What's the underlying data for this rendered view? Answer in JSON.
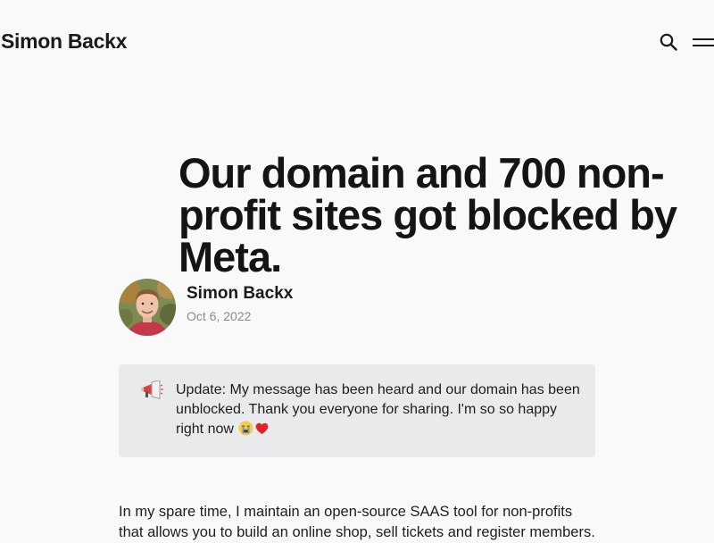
{
  "header": {
    "site_title": "Simon Backx",
    "search_icon": "search-icon",
    "menu_icon": "hamburger-menu-icon"
  },
  "post": {
    "title_lines": [
      "Our domain and 700 non-",
      "profit sites got blocked by",
      "Meta."
    ],
    "author": {
      "name": "Simon Backx",
      "date": "Oct 6, 2022",
      "avatar_icon": "author-avatar"
    }
  },
  "callout": {
    "icon": "megaphone-icon",
    "lines": [
      "Update: My message has been heard and our domain has been",
      "unblocked. Thank you everyone for sharing. I'm so so happy",
      "right now"
    ],
    "emojis": [
      "crying-face-icon",
      "red-heart-icon"
    ]
  },
  "body": {
    "lines": [
      "In my spare time, I maintain an open-source SAAS tool for non-profits",
      "that allows you to build an online shop, sell tickets and register members."
    ]
  },
  "colors": {
    "background": "#f9f9f9",
    "text": "#1a1a1a",
    "muted": "#8a8a8a",
    "callout_bg": "#e9eaec"
  }
}
